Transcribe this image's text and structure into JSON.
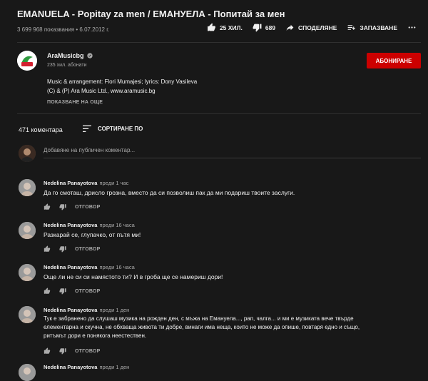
{
  "video": {
    "title": "EMANUELA - Popitay za men / ЕМАНУЕЛА - Попитай за мен",
    "views": "3 699 968 показвания",
    "date": "6.07.2012 г.",
    "likes": "25 ХИЛ.",
    "dislikes": "689",
    "share_label": "СПОДЕЛЯНЕ",
    "save_label": "ЗАПАЗВАНЕ"
  },
  "channel": {
    "name": "AraMusicbg",
    "subscribers": "235 хил. абонати",
    "subscribe_label": "АБОНИРАНЕ",
    "description_line1": "Music & arrangement: Flori Mumajesi; lyrics: Dony Vasileva",
    "description_line2": "(C) & (P) Ara Music Ltd., www.aramusic.bg",
    "show_more": "ПОКАЗВАНЕ НА ОЩЕ"
  },
  "comments_header": {
    "count": "471 коментара",
    "sort_label": "СОРТИРАНЕ ПО",
    "add_placeholder": "Добавяне на публичен коментар..."
  },
  "comments": [
    {
      "author": "Nedelina Panayotova",
      "time": "преди 1 час",
      "text": "Да го смоташ, дрисло грозна, вместо да си позволиш пак да ми подариш твоите заслуги.",
      "reply": "ОТГОВОР"
    },
    {
      "author": "Nedelina Panayotova",
      "time": "преди 16 часа",
      "text": "Разкарай се, глупачко, от пътя ми!",
      "reply": "ОТГОВОР"
    },
    {
      "author": "Nedelina Panayotova",
      "time": "преди 16 часа",
      "text": "Още ли не си си намястото ти? И в гроба ще се намериш дори!",
      "reply": "ОТГОВОР"
    },
    {
      "author": "Nedelina Panayotova",
      "time": "преди 1 ден",
      "text_line1": "Тук е забранено да слушаш музика на рожден ден, с мъжа на Емануела..., рап, чалга... и ми е музиката вече твърде",
      "text_line2": "елементарна и скучна, не обхваща живота ти добре, винаги има неща, които не може да опише, повтаря едно и също,",
      "text_line3": "ритъмът дори е понякога неестествен.",
      "reply": "ОТГОВОР"
    },
    {
      "author": "Nedelina Panayotova",
      "time": "преди 1 ден"
    }
  ],
  "colors": {
    "background": "#181818",
    "subscribe": "#cc0000",
    "secondary_text": "#aaaaaa"
  }
}
